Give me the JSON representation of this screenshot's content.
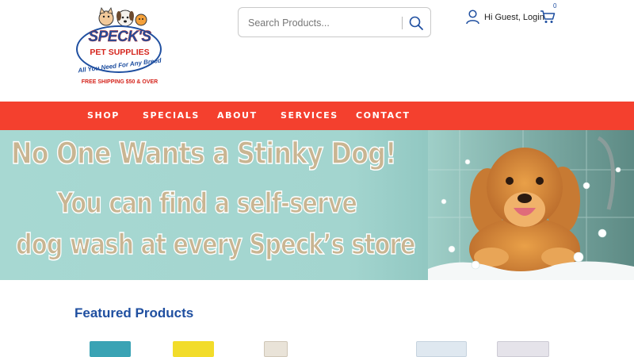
{
  "brand": {
    "name": "SPECK'S",
    "sub": "PET SUPPLIES",
    "tagline": "All You Need For Any Breed",
    "shipping": "FREE SHIPPING $50 & OVER"
  },
  "search": {
    "placeholder": "Search Products..."
  },
  "account": {
    "login_label": "Hi Guest, Login",
    "cart_count": "0"
  },
  "nav": {
    "items": [
      "SHOP",
      "SPECIALS",
      "ABOUT",
      "SERVICES",
      "CONTACT"
    ]
  },
  "banner": {
    "line1": "No One Wants a Stinky Dog!",
    "line2": "You can find a self-serve",
    "line3": "dog wash at every Speck’s store"
  },
  "featured": {
    "title": "Featured Products"
  },
  "colors": {
    "nav_bg": "#f4402e",
    "brand_blue": "#1f4fa0",
    "brand_red": "#d5251d",
    "banner_teal": "#a7d8d2"
  }
}
